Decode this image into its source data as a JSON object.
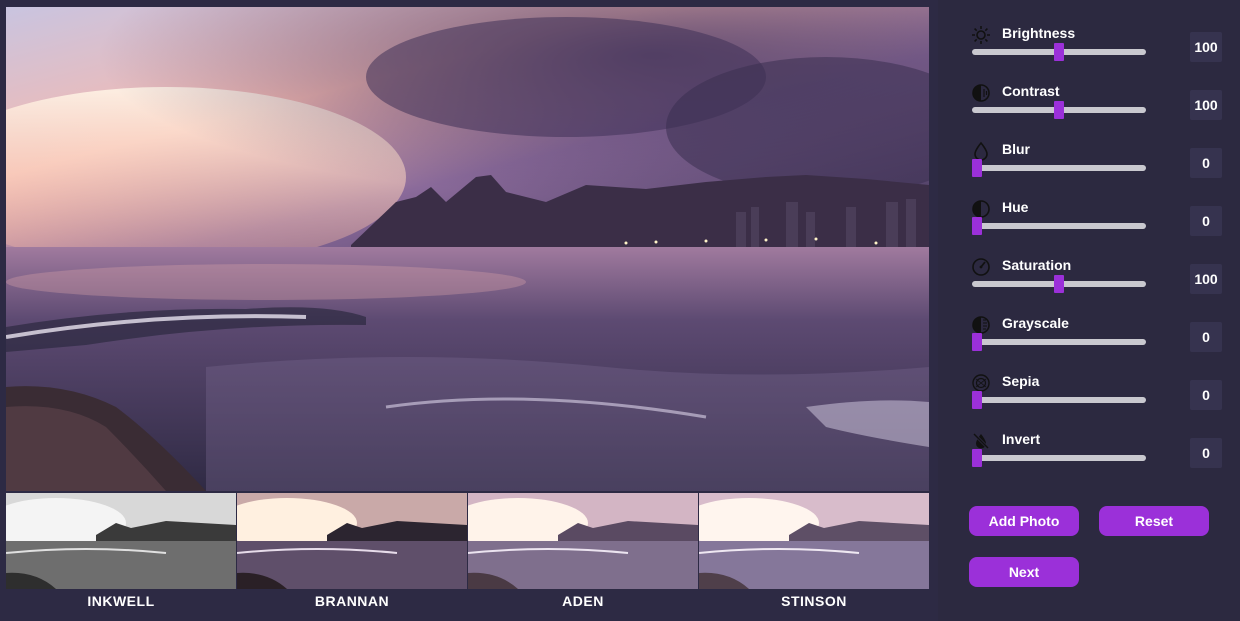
{
  "main_image": {
    "alt_icon": "sunset-beach-photo"
  },
  "filters": [
    {
      "label": "INKWELL"
    },
    {
      "label": "BRANNAN"
    },
    {
      "label": "ADEN"
    },
    {
      "label": "STINSON"
    }
  ],
  "controls": [
    {
      "label": "Brightness",
      "value": "100",
      "fraction": 0.5,
      "icon": "brightness-icon"
    },
    {
      "label": "Contrast",
      "value": "100",
      "fraction": 0.5,
      "icon": "contrast-icon"
    },
    {
      "label": "Blur",
      "value": "0",
      "fraction": 0.0,
      "icon": "blur-drop-icon"
    },
    {
      "label": "Hue",
      "value": "0",
      "fraction": 0.0,
      "icon": "hue-icon"
    },
    {
      "label": "Saturation",
      "value": "100",
      "fraction": 0.5,
      "icon": "saturation-gauge-icon"
    },
    {
      "label": "Grayscale",
      "value": "0",
      "fraction": 0.0,
      "icon": "grayscale-icon"
    },
    {
      "label": "Sepia",
      "value": "0",
      "fraction": 0.0,
      "icon": "sepia-icon"
    },
    {
      "label": "Invert",
      "value": "0",
      "fraction": 0.0,
      "icon": "invert-icon"
    }
  ],
  "buttons": {
    "add_photo": "Add Photo",
    "reset": "Reset",
    "next": "Next"
  },
  "colors": {
    "accent": "#9b30d9",
    "panel_bg": "#2c2940",
    "track": "#c9c8cf"
  }
}
